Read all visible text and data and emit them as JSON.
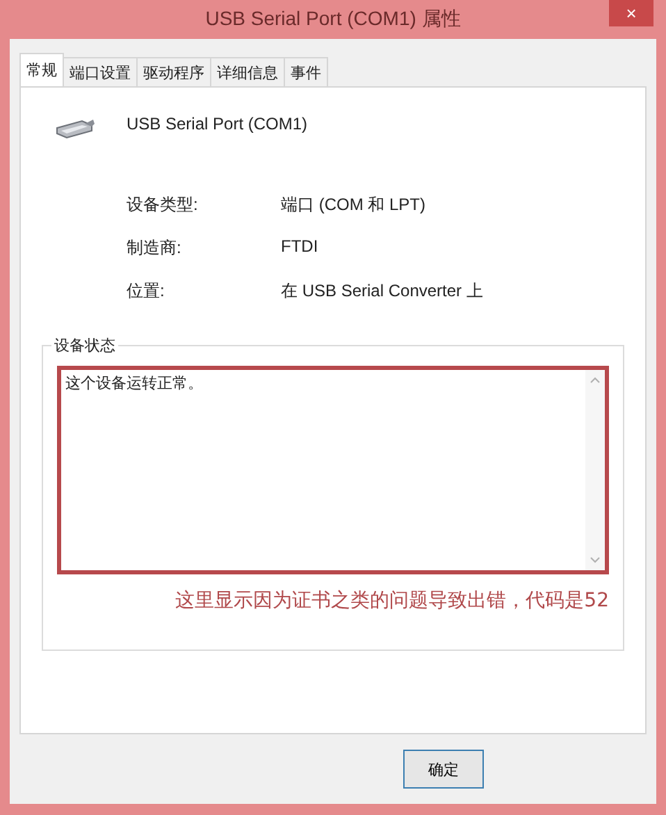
{
  "window": {
    "title": "USB Serial Port (COM1) 属性",
    "close": "×"
  },
  "tabs": [
    {
      "label": "常规",
      "selected": true
    },
    {
      "label": "端口设置",
      "selected": false
    },
    {
      "label": "驱动程序",
      "selected": false
    },
    {
      "label": "详细信息",
      "selected": false
    },
    {
      "label": "事件",
      "selected": false
    }
  ],
  "device": {
    "name": "USB Serial Port (COM1)"
  },
  "properties": [
    {
      "label": "设备类型:",
      "value": "端口 (COM 和 LPT)"
    },
    {
      "label": "制造商:",
      "value": "FTDI"
    },
    {
      "label": "位置:",
      "value": "在 USB Serial Converter 上"
    }
  ],
  "status_group": {
    "title": "设备状态",
    "text": "这个设备运转正常。",
    "highlighted": true,
    "annotation": "这里显示因为证书之类的问题导致出错，代码是52"
  },
  "buttons": [
    {
      "label": "确定",
      "default": true
    }
  ]
}
